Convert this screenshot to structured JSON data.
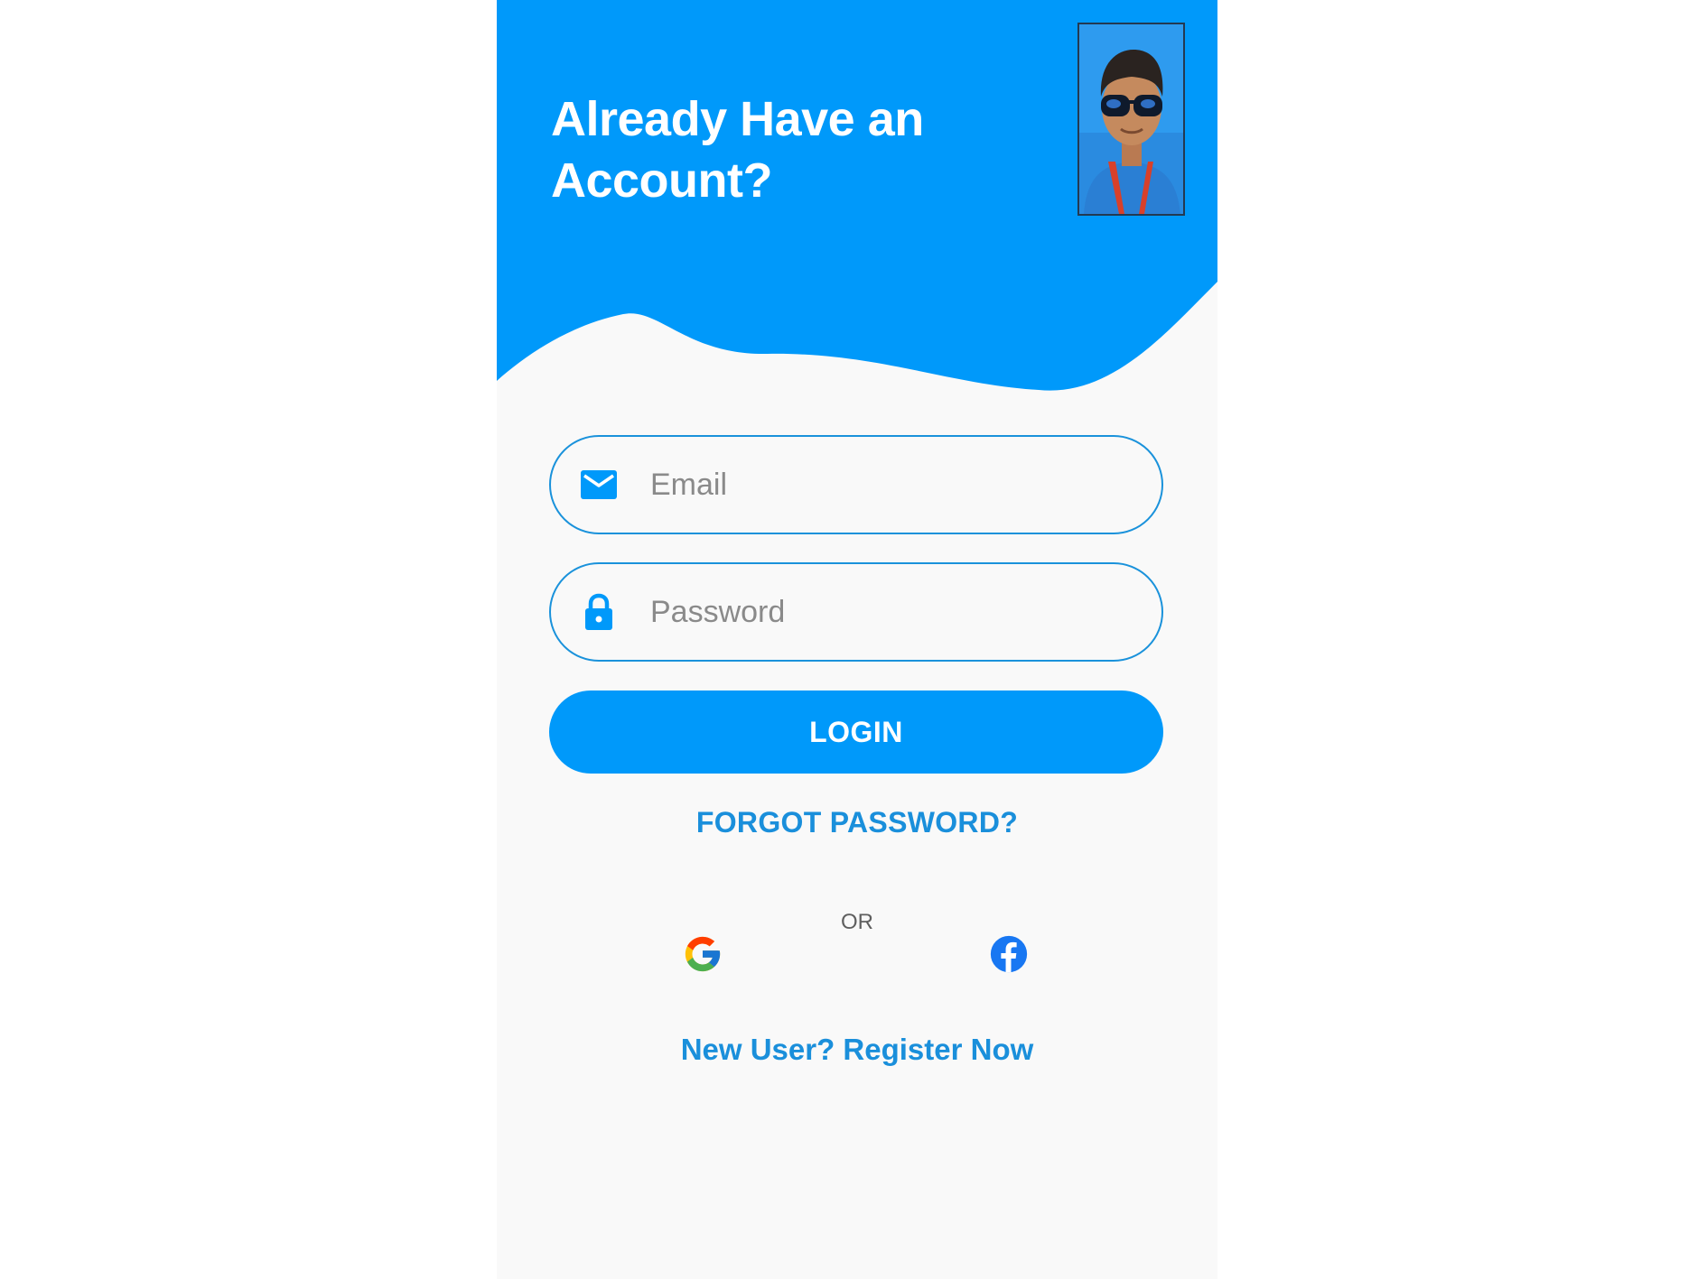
{
  "header": {
    "title_line1": "Already Have an",
    "title_line2": "Account?"
  },
  "form": {
    "email": {
      "placeholder": "Email",
      "value": "",
      "icon": "email-icon"
    },
    "password": {
      "placeholder": "Password",
      "value": "",
      "icon": "lock-icon"
    },
    "login_label": "LOGIN",
    "forgot_label": "FORGOT PASSWORD?"
  },
  "social": {
    "or_label": "OR",
    "providers": [
      "google-icon",
      "facebook-icon"
    ]
  },
  "register_label": "New User? Register Now",
  "colors": {
    "accent": "#0099fa",
    "link": "#1a8fdb",
    "background": "#f9f9f9"
  }
}
